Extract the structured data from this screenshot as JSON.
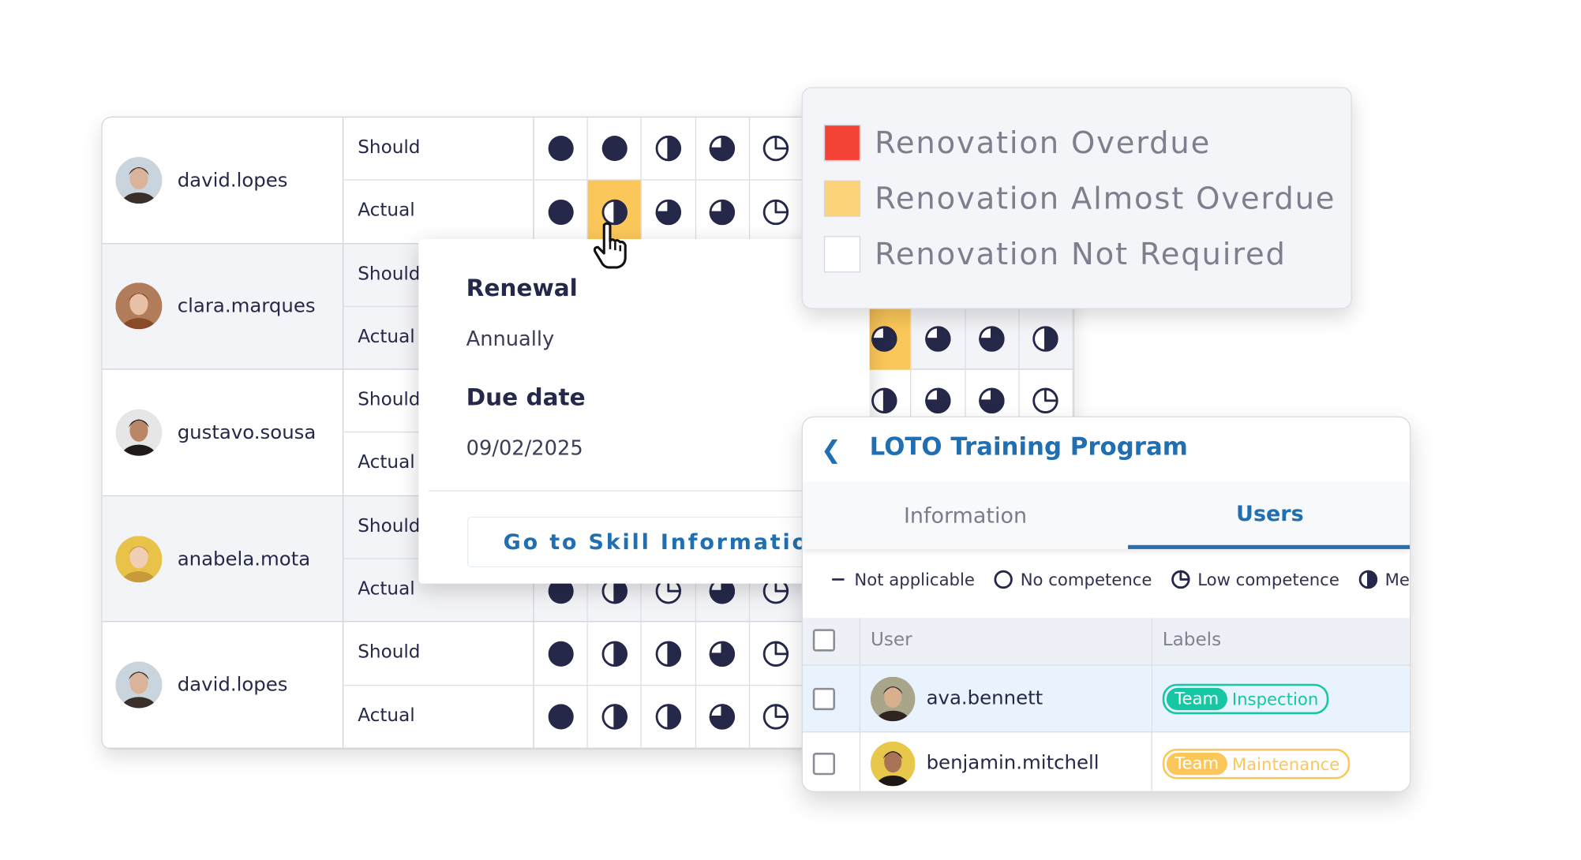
{
  "colors": {
    "ink": "#252848",
    "overdue": "#f44336",
    "almost_overdue": "#fcc75a",
    "not_required": "#ffffff",
    "accent_blue": "#1f6fb2",
    "team_inspection": "#17c6a3",
    "team_maintenance": "#fcc75a"
  },
  "matrix": {
    "rows": [
      {
        "user": "david.lopes",
        "avatar": {
          "skin": "#d9b39a",
          "hair": "#3a2f2a",
          "bg": "#c9d4dc"
        },
        "should_label": "Should",
        "actual_label": "Actual",
        "should": [
          1,
          1,
          0.5,
          0.75,
          0.25,
          null,
          null,
          null,
          null,
          null
        ],
        "actual": [
          1,
          0.5,
          0.75,
          0.75,
          0.25,
          null,
          null,
          null,
          null,
          null
        ],
        "actual_status": [
          null,
          "almost_overdue",
          null,
          null,
          null,
          null,
          null,
          null,
          null,
          null
        ],
        "should_status": []
      },
      {
        "user": "clara.marques",
        "avatar": {
          "skin": "#e8c0a6",
          "hair": "#8a4a2a",
          "bg": "#b07c5a"
        },
        "should_label": "Should",
        "actual_label": "Actual",
        "should": [
          null,
          null,
          null,
          null,
          null,
          null,
          null,
          null,
          null,
          null
        ],
        "actual": [
          null,
          null,
          null,
          null,
          null,
          null,
          0.75,
          0.75,
          0.75,
          0.5
        ],
        "actual_status": [
          null,
          null,
          null,
          null,
          null,
          null,
          "almost_overdue",
          null,
          null,
          null
        ],
        "should_status": []
      },
      {
        "user": "gustavo.sousa",
        "avatar": {
          "skin": "#b98666",
          "hair": "#1f1a18",
          "bg": "#e6e6e6"
        },
        "should_label": "Should",
        "actual_label": "Actual",
        "should": [
          null,
          null,
          null,
          null,
          null,
          null,
          0.5,
          0.75,
          0.75,
          0.25
        ],
        "actual": [
          null,
          null,
          null,
          null,
          null,
          null,
          null,
          null,
          null,
          null
        ],
        "actual_status": [],
        "should_status": []
      },
      {
        "user": "anabela.mota",
        "avatar": {
          "skin": "#f0cfb4",
          "hair": "#c89a3a",
          "bg": "#e9c24a"
        },
        "should_label": "Should",
        "actual_label": "Actual",
        "should": [
          null,
          null,
          null,
          null,
          null,
          null,
          null,
          null,
          null,
          null
        ],
        "actual": [
          1,
          0.5,
          0.25,
          0.75,
          0.25,
          null,
          null,
          null,
          null,
          null
        ],
        "actual_status": [],
        "should_status": []
      },
      {
        "user": "david.lopes",
        "avatar": {
          "skin": "#d9b39a",
          "hair": "#3a2f2a",
          "bg": "#c9d4dc"
        },
        "should_label": "Should",
        "actual_label": "Actual",
        "should": [
          1,
          0.5,
          0.5,
          0.75,
          0.25,
          null,
          null,
          null,
          null,
          null
        ],
        "actual": [
          1,
          0.5,
          0.5,
          0.75,
          0.25,
          null,
          null,
          null,
          null,
          null
        ],
        "actual_status": [],
        "should_status": []
      }
    ]
  },
  "popup": {
    "renewal_label": "Renewal",
    "renewal_value": "Annually",
    "due_label": "Due date",
    "due_value": "09/02/2025",
    "button": "Go to Skill Information"
  },
  "legend": {
    "items": [
      {
        "label": "Renovation Overdue",
        "color": "#f44336"
      },
      {
        "label": "Renovation Almost Overdue",
        "color": "#fcd27a"
      },
      {
        "label": "Renovation Not Required",
        "color": "#ffffff"
      }
    ]
  },
  "loto": {
    "back_icon": "chevron-left-icon",
    "title": "LOTO Training Program",
    "tabs": [
      {
        "label": "Information",
        "active": false
      },
      {
        "label": "Users",
        "active": true
      }
    ],
    "competence_legend": [
      {
        "label": "Not applicable",
        "icon": "dash"
      },
      {
        "label": "No competence",
        "icon": "empty-circle"
      },
      {
        "label": "Low competence",
        "icon": "quarter-circle"
      },
      {
        "label": "Med",
        "icon": "half-circle"
      }
    ],
    "table": {
      "headers": {
        "user": "User",
        "labels": "Labels"
      },
      "rows": [
        {
          "user": "ava.bennett",
          "tag_key": "Team",
          "tag_value": "Inspection",
          "tag_color": "#17c6a3",
          "highlighted": true,
          "avatar": {
            "skin": "#d8b08e",
            "hair": "#2e2420",
            "bg": "#a9a58a"
          }
        },
        {
          "user": "benjamin.mitchell",
          "tag_key": "Team",
          "tag_value": "Maintenance",
          "tag_color": "#fcc75a",
          "highlighted": false,
          "avatar": {
            "skin": "#a87356",
            "hair": "#1d1715",
            "bg": "#e8c84a"
          }
        }
      ]
    }
  }
}
